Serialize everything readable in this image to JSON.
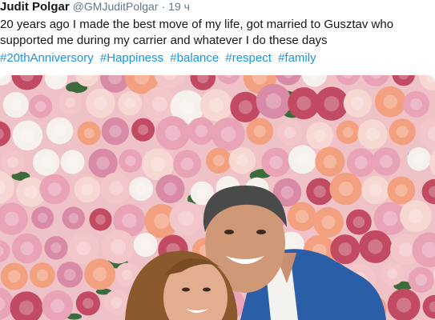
{
  "tweet": {
    "author_name": "Judit Polgar",
    "author_handle": "@GMJuditPolgar",
    "separator": "·",
    "time": "19 ч",
    "text": "20 years ago I made the best move of my life, got married to Gusztav who supported me during my carrier and whatever I do these days",
    "hashtags": [
      "#20thAnniversory",
      "#Happiness",
      "#balance",
      "#respect",
      "#family"
    ],
    "photo": {
      "subject": "couple in front of flower wall",
      "colors": {
        "flowers_pink": "#e8a3b7",
        "flowers_peach": "#f2a07f",
        "flowers_white": "#f7f1ee",
        "leaves": "#3b6b3a",
        "jacket": "#2a5fa8",
        "hair": "#8a5a2e"
      }
    }
  }
}
